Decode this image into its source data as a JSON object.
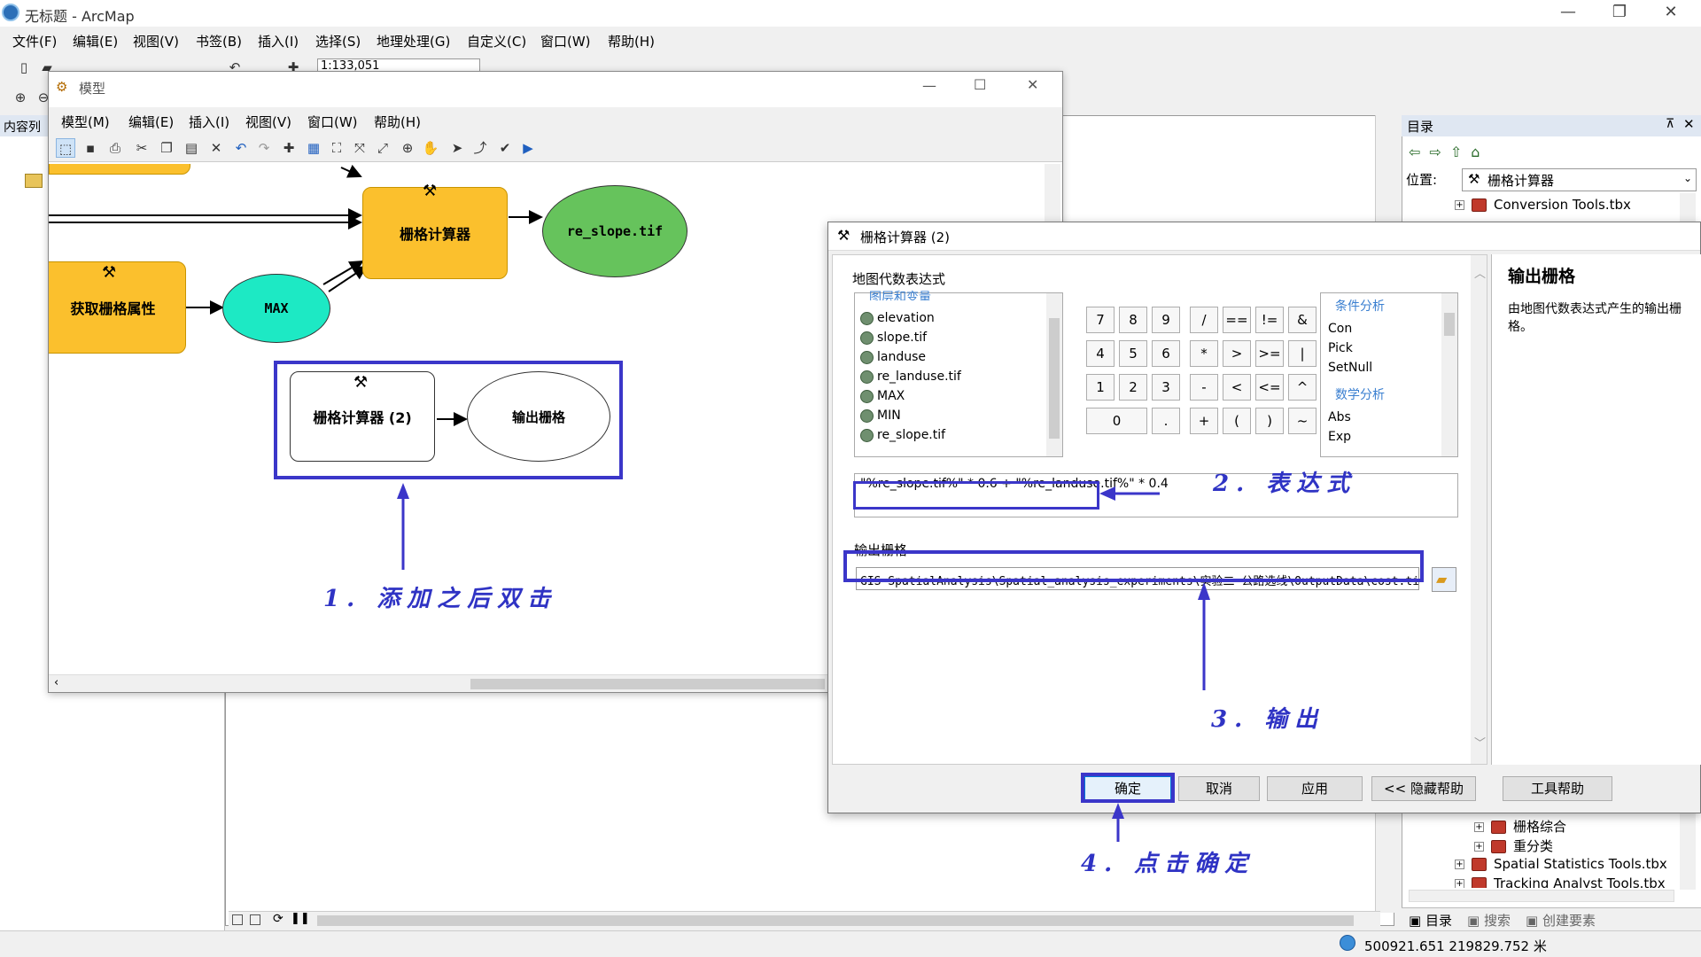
{
  "app": {
    "title": "无标题 - ArcMap",
    "menus": [
      "文件(F)",
      "编辑(E)",
      "视图(V)",
      "书签(B)",
      "插入(I)",
      "选择(S)",
      "地理处理(G)",
      "自定义(C)",
      "窗口(W)",
      "帮助(H)"
    ],
    "scale": "1:133,051",
    "toc_title": "内容列"
  },
  "catalog": {
    "title": "目录",
    "location_label": "位置:",
    "location_value": "栅格计算器",
    "items": [
      "Conversion Tools.tbx",
      "栅格综合",
      "重分类",
      "Spatial Statistics Tools.tbx",
      "Tracking Analyst Tools.tbx"
    ],
    "tabs": [
      "目录",
      "搜索",
      "创建要素"
    ]
  },
  "status": {
    "coords": "500921.651  219829.752 米"
  },
  "model": {
    "title": "模型",
    "menus": [
      "模型(M)",
      "编辑(E)",
      "插入(I)",
      "视图(V)",
      "窗口(W)",
      "帮助(H)"
    ],
    "nodes": {
      "calc1": "栅格计算器",
      "reslope": "re_slope.tif",
      "getprop": "获取栅格属性",
      "max": "MAX",
      "calc2": "栅格计算器 (2)",
      "output": "输出栅格"
    }
  },
  "rc": {
    "title": "栅格计算器 (2)",
    "map_algebra_label": "地图代数表达式",
    "layers_header": "图层和变量",
    "layers": [
      "elevation",
      "slope.tif",
      "landuse",
      "re_landuse.tif",
      "MAX",
      "MIN",
      "re_slope.tif"
    ],
    "buttons": [
      "7",
      "8",
      "9",
      "/",
      "==",
      "!=",
      "&",
      "4",
      "5",
      "6",
      "*",
      ">",
      ">=",
      "|",
      "1",
      "2",
      "3",
      "-",
      "<",
      "<=",
      "^",
      "0",
      ".",
      "+",
      "(",
      ")",
      "~"
    ],
    "func_group1": "条件分析",
    "func_items1": [
      "Con",
      "Pick",
      "SetNull"
    ],
    "func_group2": "数学分析",
    "func_items2": [
      "Abs",
      "Exp"
    ],
    "expression": "\"%re_slope.tif%\" * 0.6 + \"%re_landuse.tif%\" * 0.4",
    "output_label": "输出栅格",
    "output_path": "GIS-SpatialAnalysis\\Spatial_analysis_experiments\\实验二 公路选线\\OutputData\\cost.tif",
    "help_title": "输出栅格",
    "help_text": "由地图代数表达式产生的输出栅格。",
    "btn_ok": "确定",
    "btn_cancel": "取消",
    "btn_apply": "应用",
    "btn_hide": "<< 隐藏帮助",
    "btn_toolhelp": "工具帮助"
  },
  "annotations": {
    "a1": "1. 添加之后双击",
    "a2": "2. 表达式",
    "a3": "3. 输出",
    "a4": "4. 点击确定",
    "color": "#3b36c9"
  }
}
